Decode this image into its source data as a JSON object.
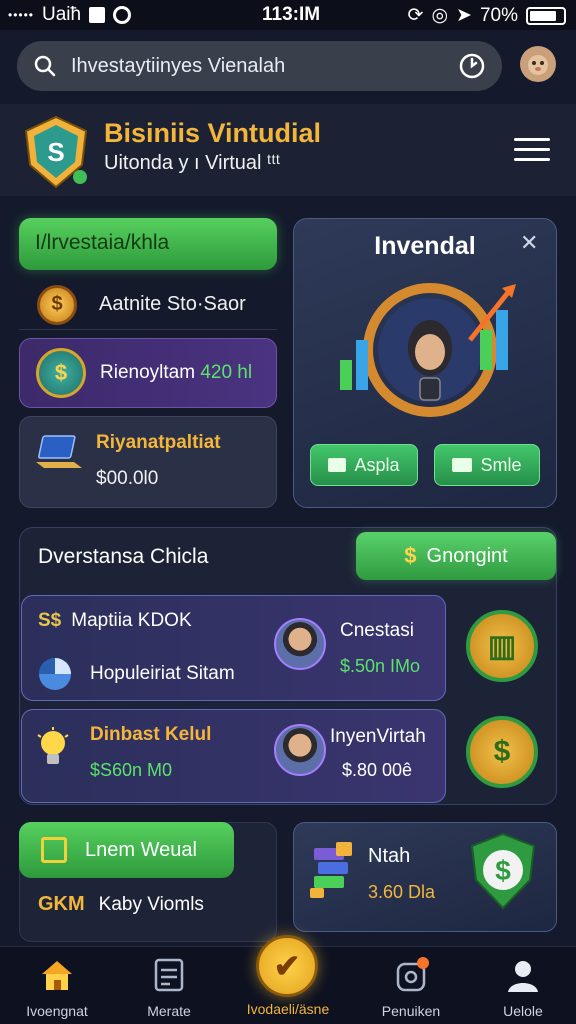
{
  "status_bar": {
    "carrier": "Uaiħ",
    "time": "113:IM",
    "battery": "70%",
    "signal_glyph": "•••••"
  },
  "search": {
    "query": "Ihvestaytiinyes Vienalah"
  },
  "header": {
    "title": "Bisiniis Vintudial",
    "subtitle": "Uitonda y ı Virtual ᵗᵗᵗ"
  },
  "left": {
    "pill": "I/lrvestaia/khla",
    "row1": "Aatnite Sto·Saor",
    "row2_label": "Rienoyltam",
    "row2_value": "420 hl",
    "card_title": "Riyanatpaltiat",
    "card_value": "$00.0l0"
  },
  "promo": {
    "title": "Invendal",
    "btn_a": "Aspla",
    "btn_b": "Smle"
  },
  "panel": {
    "title": "Dverstansa Chicla",
    "action": "Gnongint",
    "action_symbol": "$",
    "cards": [
      {
        "tag": "S$",
        "line1": "Maptiia KDOK",
        "line2": "Hopuleiriat Sitam",
        "name": "Cnestasi",
        "value": "$.50n IMo"
      },
      {
        "line1": "Dinbast Kelul",
        "line2": "$S60n M0",
        "name": "InyenVirtah",
        "value": "$.80 00ê"
      }
    ]
  },
  "bottom_left": {
    "pill": "Lnem Weual",
    "tag": "GKM",
    "text": "Kaby Viomls"
  },
  "bottom_right": {
    "title": "Ntah",
    "value": "3.60 Dla"
  },
  "nav": [
    {
      "label": "Ivoengnat",
      "icon": "home-icon"
    },
    {
      "label": "Merate",
      "icon": "calculator-icon"
    },
    {
      "label": "Ivodaeli/äsne",
      "icon": "check-icon"
    },
    {
      "label": "Penuiken",
      "icon": "settings-icon"
    },
    {
      "label": "Uelole",
      "icon": "user-icon"
    }
  ],
  "colors": {
    "accent_green": "#4cc45c",
    "accent_gold": "#f4b63a",
    "background": "#141a2c"
  }
}
